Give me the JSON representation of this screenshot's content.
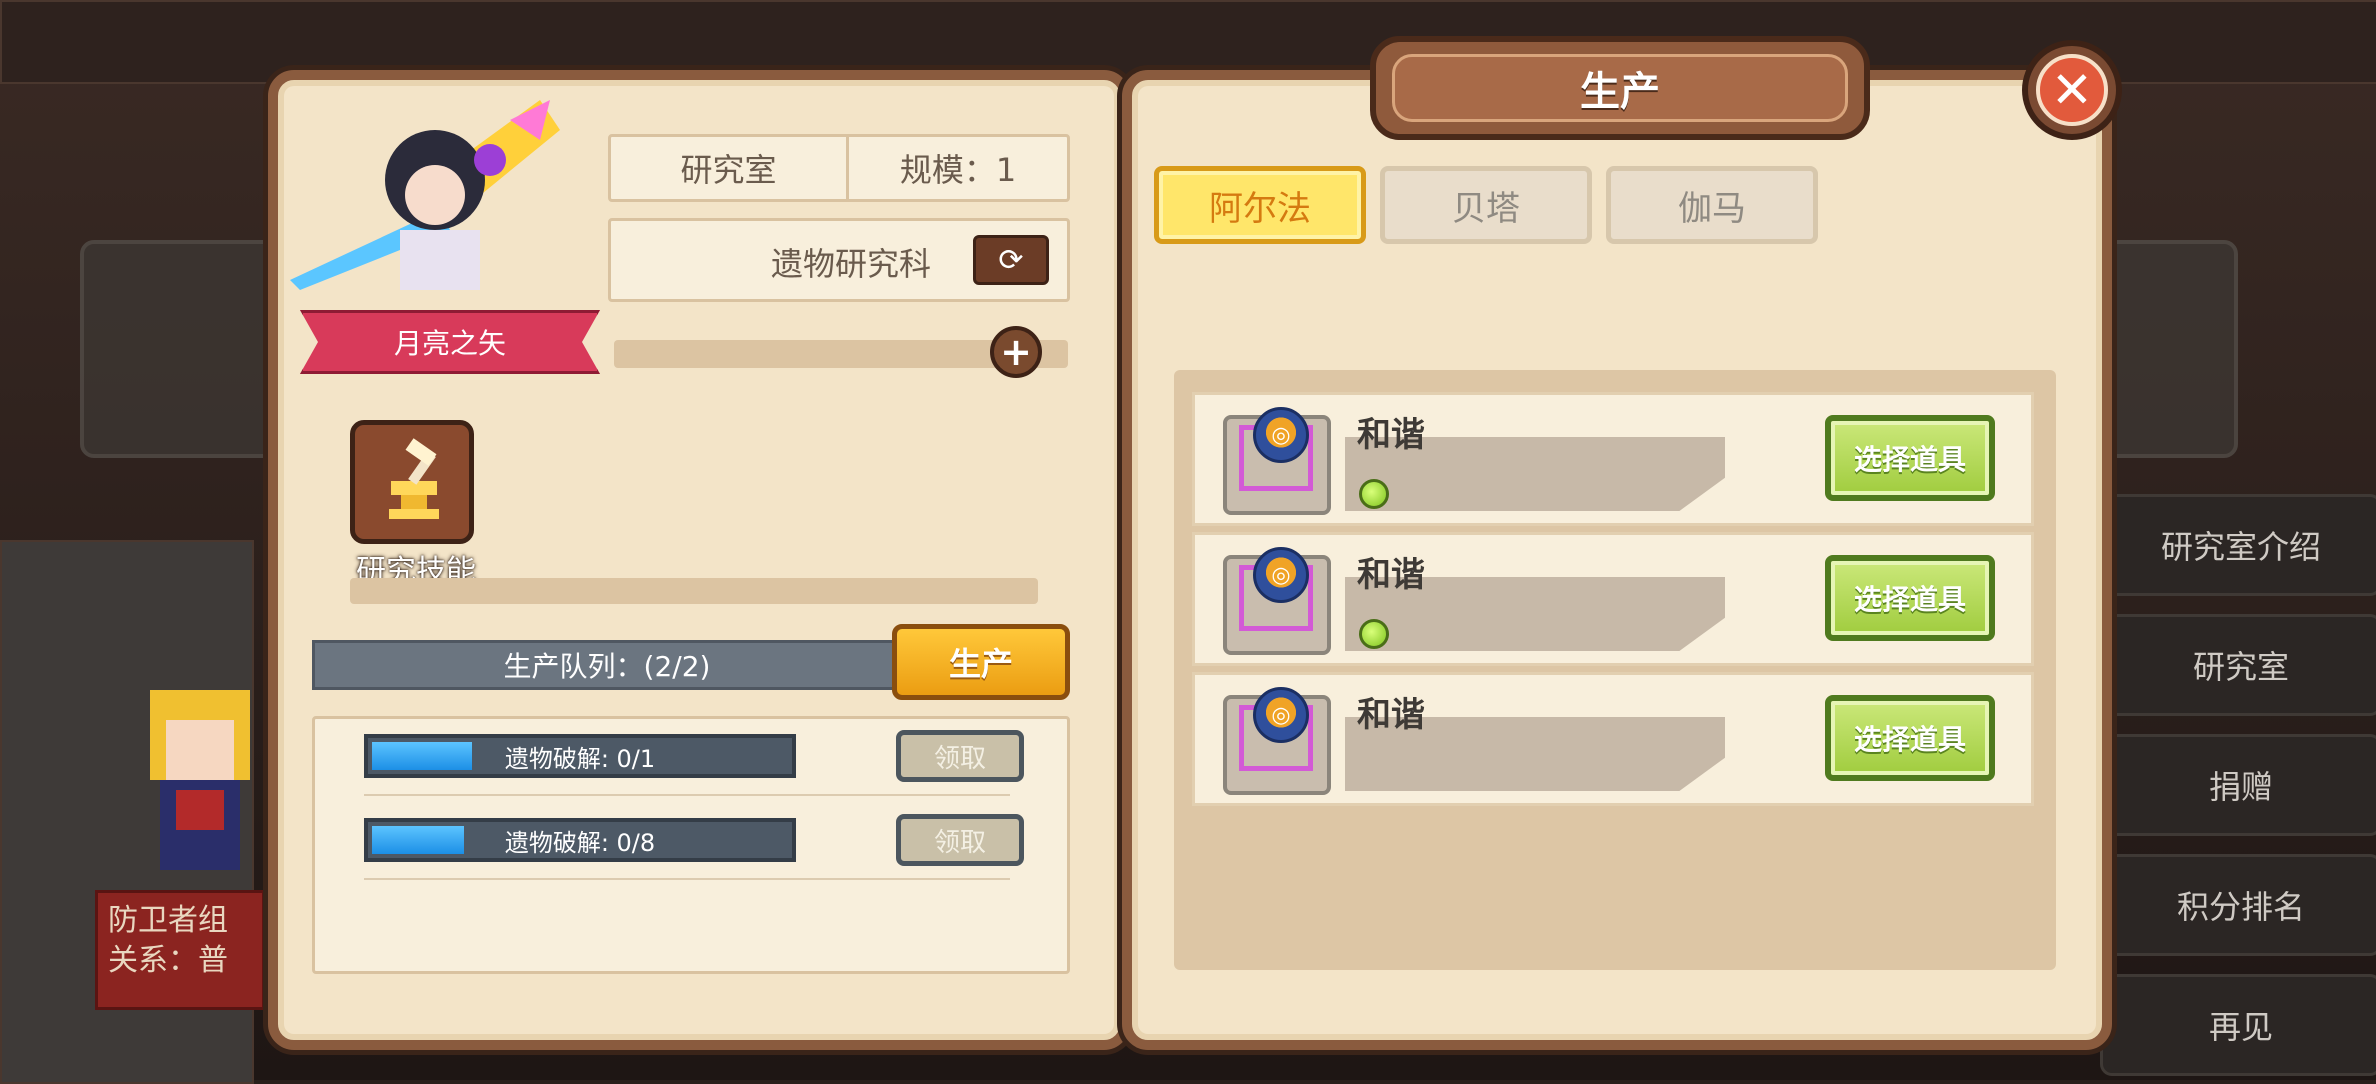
{
  "hero": {
    "name": "月亮之矢",
    "skill_label": "研究技能"
  },
  "lab": {
    "room_label": "研究室",
    "scale_label": "规模：1",
    "department": "遗物研究科"
  },
  "queue": {
    "title": "生产队列：(2/2)",
    "produce_button": "生产",
    "items": [
      {
        "label": "遗物破解: 0/1",
        "progress": 0.25,
        "claim": "领取"
      },
      {
        "label": "遗物破解: 0/8",
        "progress": 0.22,
        "claim": "领取"
      }
    ]
  },
  "production": {
    "title": "生产",
    "tabs": [
      {
        "label": "阿尔法",
        "active": true
      },
      {
        "label": "贝塔",
        "active": false
      },
      {
        "label": "伽马",
        "active": false
      }
    ],
    "rows": [
      {
        "name": "和谐",
        "has_dot": true,
        "button": "选择道具"
      },
      {
        "name": "和谐",
        "has_dot": true,
        "button": "选择道具"
      },
      {
        "name": "和谐",
        "has_dot": false,
        "button": "选择道具"
      }
    ]
  },
  "side_menu": [
    "研究室介绍",
    "研究室",
    "捐赠",
    "积分排名",
    "再见"
  ],
  "background": {
    "npc_title": "防卫者组",
    "npc_relation": "关系：普"
  },
  "colors": {
    "panel": "#f3e4c8",
    "panel_border": "#8a5b3e",
    "gold": "#ffc83a",
    "green": "#a0cc3e",
    "progress": "#1c8fe6"
  }
}
